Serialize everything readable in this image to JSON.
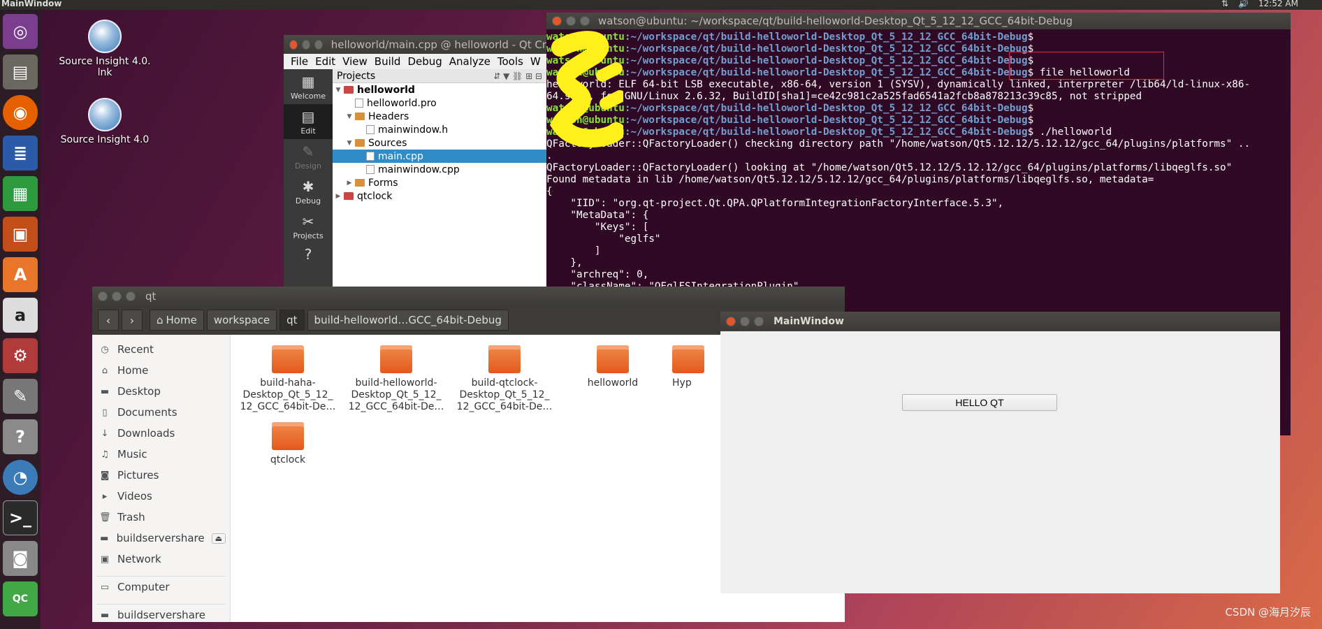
{
  "topbar": {
    "title": "MainWindow",
    "time": "12:52 AM"
  },
  "desktop": {
    "icon1": "Source Insight 4.0.\nlnk",
    "icon2": "Source Insight 4.0"
  },
  "launcher": [
    "ubuntu-icon",
    "files-icon",
    "firefox-icon",
    "writer-icon",
    "calc-icon",
    "impress-icon",
    "software-icon",
    "amazon-icon",
    "settings-icon",
    "editor-icon",
    "help-icon",
    "source-insight-icon",
    "terminal-icon",
    "camera-icon",
    "qtcreator-icon"
  ],
  "qtcreator": {
    "title": "helloworld/main.cpp @ helloworld - Qt Cr",
    "menu": [
      "File",
      "Edit",
      "View",
      "Build",
      "Debug",
      "Analyze",
      "Tools",
      "W"
    ],
    "modes": [
      "Welcome",
      "Edit",
      "Design",
      "Debug",
      "Projects"
    ],
    "panel_title": "Projects",
    "tree": [
      "helloworld",
      "helloworld.pro",
      "Headers",
      "mainwindow.h",
      "Sources",
      "main.cpp",
      "mainwindow.cpp",
      "Forms",
      "qtclock"
    ]
  },
  "terminal": {
    "title": "watson@ubuntu: ~/workspace/qt/build-helloworld-Desktop_Qt_5_12_12_GCC_64bit-Debug",
    "prompt_user": "watson@ubuntu",
    "prompt_path": ":~/workspace/qt/build-helloworld-Desktop_Qt_5_12_12_GCC_64bit-Debug",
    "cmd_file": "$ file helloworld",
    "out1": "helloworld: ELF 64-bit LSB executable, x86-64, version 1 (SYSV), dynamically linked, interpreter /lib64/ld-linux-x86-",
    "out2": "64.so.2, for GNU/Linux 2.6.32, BuildID[sha1]=ce42c981c2a525fad6541a2fcb8a878213c39c85, not stripped",
    "cmd_run": "$ ./helloworld",
    "out3": "QFactoryLoader::QFactoryLoader() checking directory path \"/home/watson/Qt5.12.12/5.12.12/gcc_64/plugins/platforms\" ..",
    "out4": ".",
    "out5": "QFactoryLoader::QFactoryLoader() looking at \"/home/watson/Qt5.12.12/5.12.12/gcc_64/plugins/platforms/libqeglfs.so\"",
    "out6": "Found metadata in lib /home/watson/Qt5.12.12/5.12.12/gcc_64/plugins/platforms/libqeglfs.so, metadata=",
    "out7": "{",
    "out8": "    \"IID\": \"org.qt-project.Qt.QPA.QPlatformIntegrationFactoryInterface.5.3\",",
    "out9": "    \"MetaData\": {",
    "out10": "        \"Keys\": [",
    "out11": "            \"eglfs\"",
    "out12": "        ]",
    "out13": "    },",
    "out14": "    \"archreq\": 0,",
    "out15": "    \"className\": \"QEglFSIntegrationPlugin\","
  },
  "files": {
    "title": "qt",
    "crumbs": [
      "Home",
      "workspace",
      "qt",
      "build-helloworld…GCC_64bit-Debug"
    ],
    "sidebar": [
      "Recent",
      "Home",
      "Desktop",
      "Documents",
      "Downloads",
      "Music",
      "Pictures",
      "Videos",
      "Trash",
      "buildservershare",
      "Network",
      "Computer",
      "buildservershare"
    ],
    "items": [
      "build-haha-\nDesktop_Qt_5_12_\n12_GCC_64bit-De…",
      "build-helloworld-\nDesktop_Qt_5_12_\n12_GCC_64bit-De…",
      "build-qtclock-\nDesktop_Qt_5_12_\n12_GCC_64bit-De…",
      "helloworld",
      "Hyp",
      "qtclock"
    ]
  },
  "mainwindow": {
    "title": "MainWindow",
    "button": "HELLO QT"
  },
  "watermark": "CSDN @海月汐辰"
}
